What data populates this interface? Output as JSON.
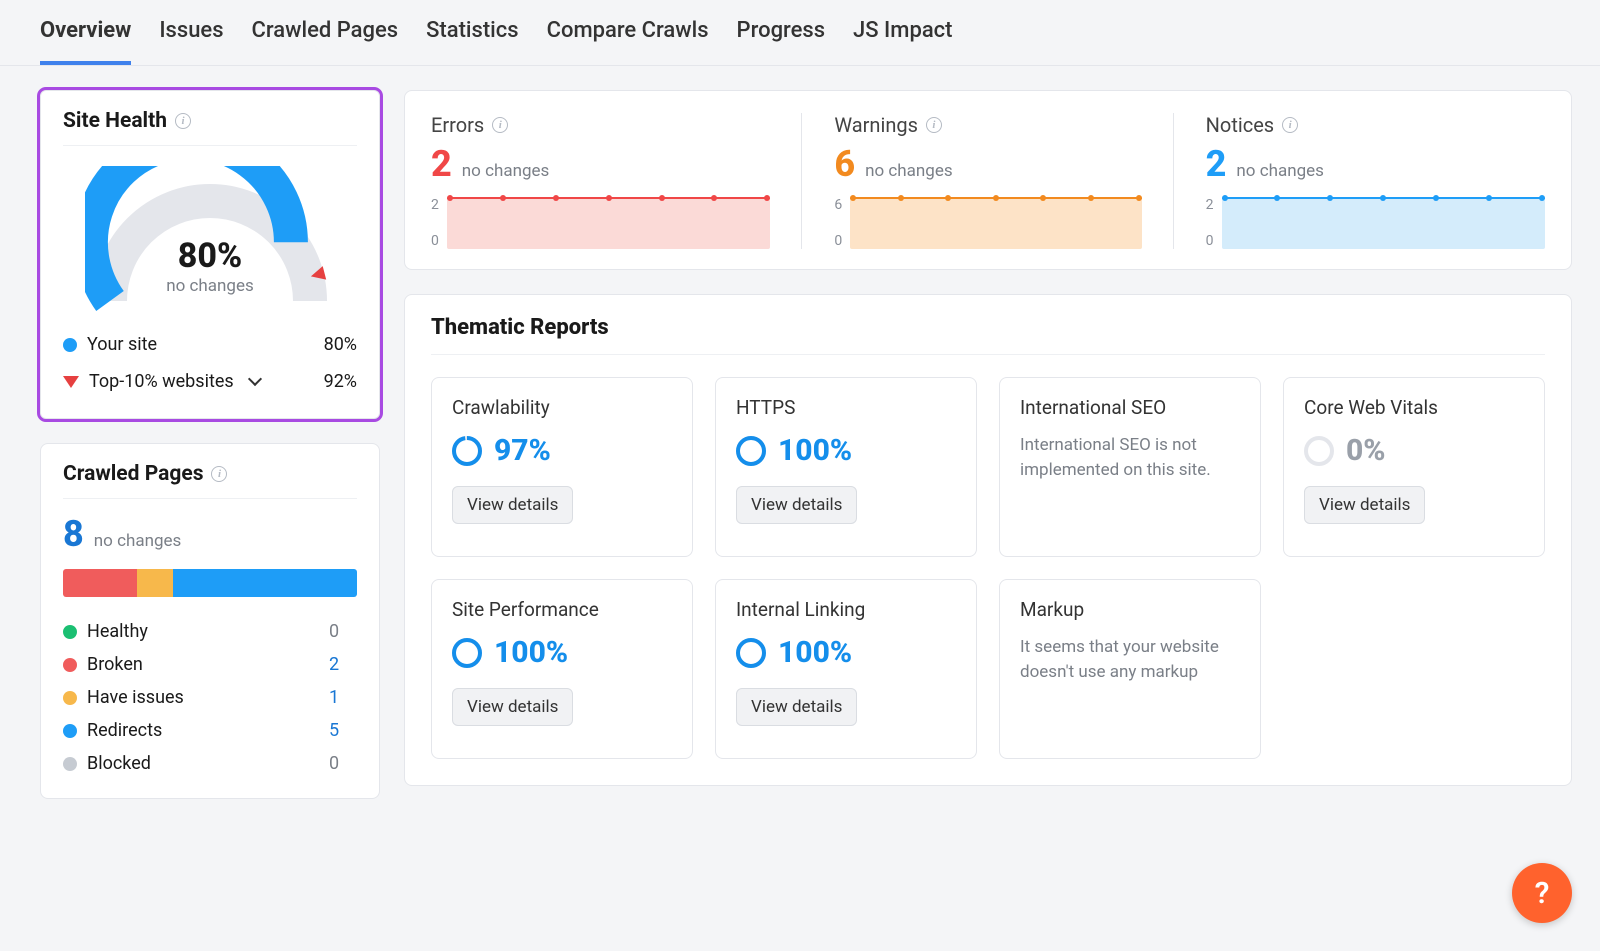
{
  "tabs": [
    "Overview",
    "Issues",
    "Crawled Pages",
    "Statistics",
    "Compare Crawls",
    "Progress",
    "JS Impact"
  ],
  "active_tab_idx": 0,
  "site_health": {
    "title": "Site Health",
    "percent": "80%",
    "percent_value": 80,
    "sub": "no changes",
    "your_site_label": "Your site",
    "your_site_value": "80%",
    "top10_label": "Top-10% websites",
    "top10_value": "92%"
  },
  "crawled_pages": {
    "title": "Crawled Pages",
    "total": "8",
    "sub": "no changes",
    "bar": [
      {
        "color": "#f05c5c",
        "flex": 2
      },
      {
        "color": "#f7b84b",
        "flex": 1
      },
      {
        "color": "#1e9df7",
        "flex": 5
      }
    ],
    "rows": [
      {
        "label": "Healthy",
        "color": "#1bbf72",
        "value": "0",
        "link": false
      },
      {
        "label": "Broken",
        "color": "#f05c5c",
        "value": "2",
        "link": true
      },
      {
        "label": "Have issues",
        "color": "#f7b84b",
        "value": "1",
        "link": true
      },
      {
        "label": "Redirects",
        "color": "#1e9df7",
        "value": "5",
        "link": true
      },
      {
        "label": "Blocked",
        "color": "#c6cbd2",
        "value": "0",
        "link": false
      }
    ]
  },
  "metrics": [
    {
      "title": "Errors",
      "value": "2",
      "sub": "no changes",
      "color": "c-red",
      "spark": "spark-red",
      "axis_top": "2",
      "axis_bottom": "0"
    },
    {
      "title": "Warnings",
      "value": "6",
      "sub": "no changes",
      "color": "c-orange",
      "spark": "spark-orange",
      "axis_top": "6",
      "axis_bottom": "0"
    },
    {
      "title": "Notices",
      "value": "2",
      "sub": "no changes",
      "color": "c-blue2",
      "spark": "spark-blue",
      "axis_top": "2",
      "axis_bottom": "0"
    }
  ],
  "thematic": {
    "title": "Thematic Reports",
    "button_label": "View details",
    "reports": [
      {
        "title": "Crawlability",
        "pct": "97%",
        "ring": 97,
        "has_button": true,
        "note": null,
        "grey": false
      },
      {
        "title": "HTTPS",
        "pct": "100%",
        "ring": 100,
        "has_button": true,
        "note": null,
        "grey": false
      },
      {
        "title": "International SEO",
        "pct": null,
        "ring": null,
        "has_button": false,
        "note": "International SEO is not implemented on this site.",
        "grey": false
      },
      {
        "title": "Core Web Vitals",
        "pct": "0%",
        "ring": 0,
        "has_button": true,
        "note": null,
        "grey": true
      },
      {
        "title": "Site Performance",
        "pct": "100%",
        "ring": 100,
        "has_button": true,
        "note": null,
        "grey": false
      },
      {
        "title": "Internal Linking",
        "pct": "100%",
        "ring": 100,
        "has_button": true,
        "note": null,
        "grey": false
      },
      {
        "title": "Markup",
        "pct": null,
        "ring": null,
        "has_button": false,
        "note": "It seems that your website doesn't use any markup",
        "grey": false
      }
    ]
  },
  "help_label": "?",
  "chart_data": {
    "gauge": {
      "type": "gauge",
      "value": 80,
      "max": 100,
      "title": "Site Health"
    },
    "sparklines": [
      {
        "type": "area",
        "title": "Errors",
        "y": [
          2,
          2,
          2,
          2,
          2,
          2,
          2
        ],
        "ylim": [
          0,
          2
        ]
      },
      {
        "type": "area",
        "title": "Warnings",
        "y": [
          6,
          6,
          6,
          6,
          6,
          6,
          6
        ],
        "ylim": [
          0,
          6
        ]
      },
      {
        "type": "area",
        "title": "Notices",
        "y": [
          2,
          2,
          2,
          2,
          2,
          2,
          2
        ],
        "ylim": [
          0,
          2
        ]
      }
    ],
    "crawled_pages_bar": {
      "type": "bar",
      "categories": [
        "Healthy",
        "Broken",
        "Have issues",
        "Redirects",
        "Blocked"
      ],
      "values": [
        0,
        2,
        1,
        5,
        0
      ]
    }
  }
}
